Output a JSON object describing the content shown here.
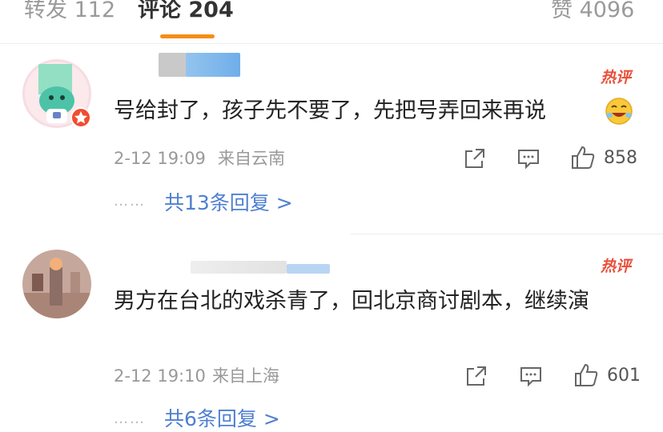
{
  "tabs": {
    "repost": "转发 112",
    "comments": "评论 204",
    "likes": "赞 4096"
  },
  "comments": [
    {
      "hot_label": "热评",
      "text": "号给封了，孩子先不要了，先把号弄回来再说",
      "time": "2-12 19:09",
      "location": "来自云南",
      "likes": "858",
      "dots": "……",
      "replies": "共13条回复 >"
    },
    {
      "hot_label": "热评",
      "text": "男方在台北的戏杀青了，回北京商讨剧本，继续演",
      "time": "2-12 19:10",
      "location": "来自上海",
      "likes": "601",
      "dots": "……",
      "replies": "共6条回复 >"
    }
  ],
  "colors": {
    "accent": "#f78d18",
    "hot": "#e8503a",
    "link": "#4f7fd0",
    "verified_badge": "#f04d32"
  },
  "icons": [
    "share-icon",
    "comment-icon",
    "like-icon",
    "laughing-emoji-icon",
    "verified-badge-icon"
  ]
}
